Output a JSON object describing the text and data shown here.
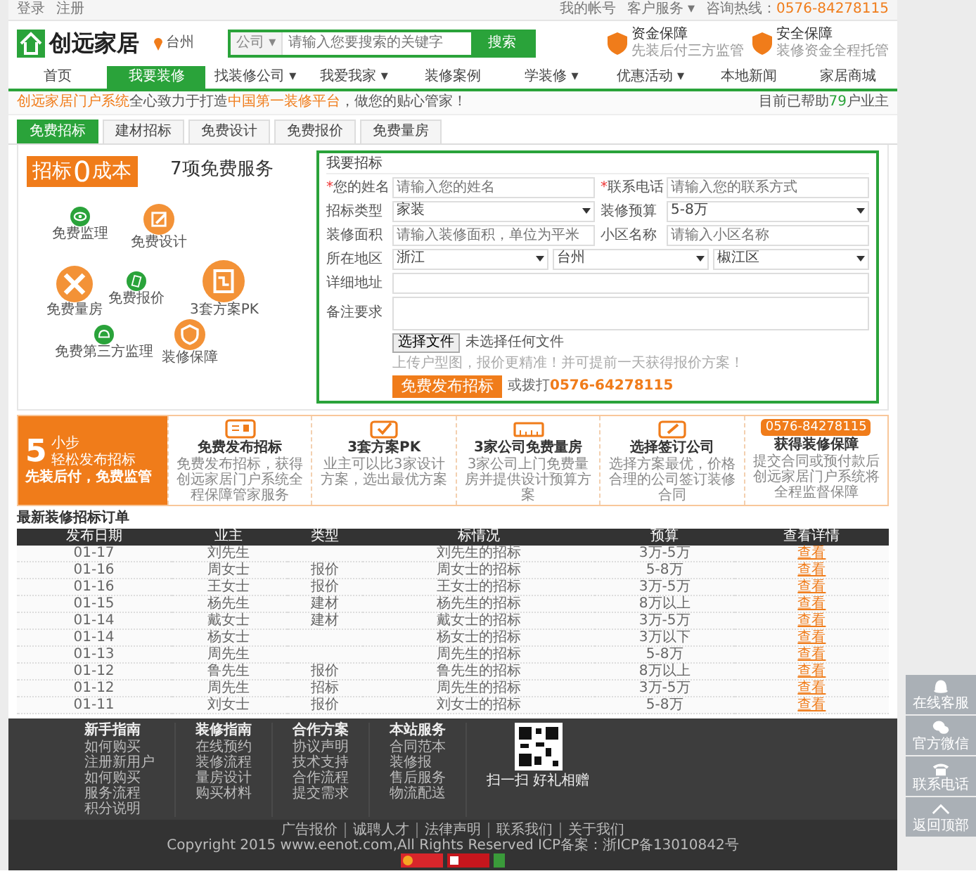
{
  "topbar": {
    "login": "登录",
    "register": "注册",
    "account": "我的帐号",
    "service": "客户服务 ▾",
    "hotline_label": "咨询热线：",
    "hotline": "0576-84278115"
  },
  "header": {
    "logo": "创远家居",
    "city": "台州",
    "search": {
      "scope": "公司 ▾",
      "placeholder": "请输入您要搜索的关键字",
      "button": "搜索"
    },
    "badges": [
      {
        "title": "资金保障",
        "text": "先装后付三方监管"
      },
      {
        "title": "安全保障",
        "text": "装修资金全程托管"
      }
    ]
  },
  "nav": [
    {
      "label": "首页",
      "selected": false
    },
    {
      "label": "我要装修",
      "selected": true
    },
    {
      "label": "找装修公司 ▾",
      "selected": false
    },
    {
      "label": "我爱我家 ▾",
      "selected": false
    },
    {
      "label": "装修案例",
      "selected": false
    },
    {
      "label": "学装修 ▾",
      "selected": false
    },
    {
      "label": "优惠活动 ▾",
      "selected": false
    },
    {
      "label": "本地新闻",
      "selected": false
    },
    {
      "label": "家居商城",
      "selected": false
    }
  ],
  "slogan": {
    "brand": "创远家居门户系统",
    "middle": "全心致力于打造",
    "highlight": "中国第一装修平台",
    "end": "，做您的贴心管家！",
    "helped_prefix": "目前已帮助",
    "helped_count": "79",
    "helped_suffix": "户业主"
  },
  "tabs": [
    {
      "label": "免费招标",
      "selected": true
    },
    {
      "label": "建材招标",
      "selected": false
    },
    {
      "label": "免费设计",
      "selected": false
    },
    {
      "label": "免费报价",
      "selected": false
    },
    {
      "label": "免费量房",
      "selected": false
    }
  ],
  "promo": {
    "tag_left": "招标",
    "tag_zero": "0",
    "tag_right": "成本",
    "headline": "7项免费服务",
    "services": [
      {
        "label": "免费监理",
        "kind": "eye",
        "color": "#2aa33a"
      },
      {
        "label": "免费设计",
        "kind": "pencil",
        "color": "#f39237"
      },
      {
        "label": "免费量房",
        "kind": "ruler",
        "color": "#f39237"
      },
      {
        "label": "免费报价",
        "kind": "note",
        "color": "#2aa33a"
      },
      {
        "label": "3套方案PK",
        "kind": "plan",
        "color": "#f39237"
      },
      {
        "label": "免费第三方监理",
        "kind": "helmet",
        "color": "#2aa33a"
      },
      {
        "label": "装修保障",
        "kind": "shield",
        "color": "#f39237"
      }
    ]
  },
  "form": {
    "title": "我要招标",
    "rows": [
      [
        {
          "marker": "*",
          "label": "您的姓名",
          "kind": "text",
          "placeholder": "请输入您的姓名"
        },
        {
          "marker": "*",
          "label": "联系电话",
          "kind": "text",
          "placeholder": "请输入您的联系方式"
        }
      ],
      [
        {
          "label": "招标类型",
          "kind": "select",
          "value": "家装"
        },
        {
          "label": "装修预算",
          "kind": "select",
          "value": "5-8万"
        }
      ],
      [
        {
          "label": "装修面积",
          "kind": "text",
          "placeholder": "请输入装修面积，单位为平米"
        },
        {
          "label": "小区名称",
          "kind": "text",
          "placeholder": "请输入小区名称"
        }
      ],
      [
        {
          "label": "所在地区",
          "kind": "selects",
          "values": [
            "浙江",
            "台州",
            "椒江区"
          ]
        }
      ],
      [
        {
          "label": "详细地址",
          "kind": "text"
        }
      ],
      [
        {
          "label": "备注要求",
          "kind": "textarea"
        }
      ]
    ],
    "file_button": "选择文件",
    "file_status": "未选择任何文件",
    "hint": "上传户型图，报价更精准！并可提前一天获得报价方案！",
    "submit": "免费发布招标",
    "call_prefix": "或拨打",
    "call_number": "0576-64278115"
  },
  "steps": {
    "count": "5",
    "unit": "小步",
    "subtitle": "轻松发布招标",
    "motto": "先装后付，免费监管",
    "items": [
      {
        "kind": "card",
        "title": "免费发布招标",
        "text": "免费发布招标，获得创远家居门户系统全程保障管家服务"
      },
      {
        "kind": "check",
        "title": "3套方案PK",
        "text": "业主可以比3家设计方案，选出最优方案"
      },
      {
        "kind": "ruler",
        "title": "3家公司免费量房",
        "text": "3家公司上门免费量房并提供设计预算方案"
      },
      {
        "kind": "sign",
        "title": "选择签订公司",
        "text": "选择方案最优，价格合理的公司签订装修合同"
      },
      {
        "kind": "phone",
        "badge": "0576-84278115",
        "title": "获得装修保障",
        "text": "提交合同或预付款后创远家居门户系统将全程监督保障"
      }
    ]
  },
  "orders": {
    "title": "最新装修招标订单",
    "columns": [
      "发布日期",
      "业主",
      "类型",
      "标情况",
      "预算",
      "查看详情"
    ],
    "rows": [
      {
        "date": "01-17",
        "owner": "刘先生",
        "title": "刘先生的招标",
        "budget": "3万-5万",
        "link": "查看"
      },
      {
        "date": "01-16",
        "owner": "周女士",
        "type": "报价",
        "title": "周女士的招标",
        "budget": "5-8万",
        "link": "查看"
      },
      {
        "date": "01-16",
        "owner": "王女士",
        "type": "报价",
        "title": "王女士的招标",
        "budget": "3万-5万",
        "link": "查看"
      },
      {
        "date": "01-15",
        "owner": "杨先生",
        "type": "建材",
        "title": "杨先生的招标",
        "budget": "8万以上",
        "link": "查看"
      },
      {
        "date": "01-14",
        "owner": "戴女士",
        "type": "建材",
        "title": "戴女士的招标",
        "budget": "3万-5万",
        "link": "查看"
      },
      {
        "date": "01-14",
        "owner": "杨女士",
        "title": "杨女士的招标",
        "budget": "3万以下",
        "link": "查看"
      },
      {
        "date": "01-13",
        "owner": "周先生",
        "title": "周先生的招标",
        "budget": "5-8万",
        "link": "查看"
      },
      {
        "date": "01-12",
        "owner": "鲁先生",
        "type": "报价",
        "title": "鲁先生的招标",
        "budget": "8万以上",
        "link": "查看"
      },
      {
        "date": "01-12",
        "owner": "周先生",
        "type": "招标",
        "title": "周先生的招标",
        "budget": "3万-5万",
        "link": "查看"
      },
      {
        "date": "01-11",
        "owner": "刘女士",
        "type": "报价",
        "title": "刘女士的招标",
        "budget": "5-8万",
        "link": "查看"
      }
    ]
  },
  "footer": {
    "columns": [
      {
        "title": "新手指南",
        "links": [
          "如何购买",
          "注册新用户",
          "如何购买",
          "服务流程",
          "积分说明"
        ]
      },
      {
        "title": "装修指南",
        "links": [
          "在线预约",
          "装修流程",
          "量房设计",
          "购买材料"
        ]
      },
      {
        "title": "合作方案",
        "links": [
          "协议声明",
          "技术支持",
          "合作流程",
          "提交需求"
        ]
      },
      {
        "title": "本站服务",
        "links": [
          "合同范本",
          "装修报",
          "售后服务",
          "物流配送"
        ]
      }
    ],
    "qr_caption": "扫一扫 好礼相赠",
    "links": [
      "广告报价",
      "诚聘人才",
      "法律声明",
      "联系我们",
      "关于我们"
    ],
    "copyright": "Copyright 2015 www.eenot.com,All Rights Reserved ICP备案：浙ICP备13010842号"
  },
  "side": [
    {
      "kind": "chat",
      "label": "在线客服"
    },
    {
      "kind": "wechat",
      "label": "官方微信"
    },
    {
      "kind": "phone",
      "label": "联系电话"
    },
    {
      "kind": "top",
      "label": "返回顶部"
    }
  ]
}
